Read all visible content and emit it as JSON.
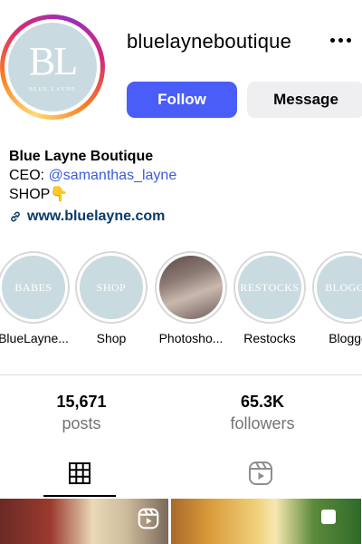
{
  "profile": {
    "username": "bluelayneboutique",
    "avatar_monogram": "BL",
    "avatar_subtitle": "BLUE LAYNE"
  },
  "actions": {
    "follow_label": "Follow",
    "message_label": "Message"
  },
  "bio": {
    "name": "Blue Layne Boutique",
    "ceo_prefix": "CEO: ",
    "ceo_mention": "@samanthas_layne",
    "shop_text": "SHOP",
    "shop_emoji": "👇",
    "link": "www.bluelayne.com"
  },
  "highlights": [
    {
      "label": "BlueLayne...",
      "cover_text": "BABES"
    },
    {
      "label": "Shop",
      "cover_text": "SHOP"
    },
    {
      "label": "Photosho...",
      "cover_text": ""
    },
    {
      "label": "Restocks",
      "cover_text": "RESTOCKS"
    },
    {
      "label": "Blogge",
      "cover_text": "BLOGGE"
    }
  ],
  "stats": {
    "posts_count": "15,671",
    "posts_label": "posts",
    "followers_count": "65.3K",
    "followers_label": "followers"
  },
  "tabs": {
    "active": "grid",
    "icons": [
      "grid-icon",
      "reels-icon"
    ]
  },
  "colors": {
    "follow_button": "#4a5df9",
    "mention": "#3b5bdb",
    "link": "#0b3a66",
    "highlight_cover": "#c9dbe0"
  }
}
